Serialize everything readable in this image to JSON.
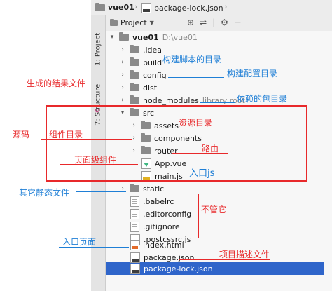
{
  "breadcrumb": {
    "project": "vue01",
    "file": "package-lock.json"
  },
  "side_tabs": {
    "project": "1: Project",
    "structure": "7: Structure"
  },
  "toolbar": {
    "view_label": "Project",
    "icons": [
      "target-icon",
      "split-icon",
      "gear-icon",
      "collapse-icon"
    ]
  },
  "tree": {
    "root": {
      "name": "vue01",
      "path": "D:\\vue01"
    },
    "items": {
      "idea": ".idea",
      "build": "build",
      "config": "config",
      "dist": "dist",
      "node_modules": "node_modules",
      "node_modules_tag": "library root",
      "src": "src",
      "assets": "assets",
      "components": "components",
      "router": "router",
      "app_vue": "App.vue",
      "main_js": "main.js",
      "static": "static",
      "babelrc": ".babelrc",
      "editorconfig": ".editorconfig",
      "gitignore": ".gitignore",
      "postcssrc": ".postcssrc.js",
      "index_html": "index.html",
      "package_json": "package.json",
      "package_lock": "package-lock.json"
    }
  },
  "annotations": {
    "build_dir": "构建脚本的目录",
    "config_dir": "构建配置目录",
    "dist_result": "生成的结果文件",
    "deps_dir": "依赖的包目录",
    "source": "源码",
    "component_dir": "组件目录",
    "asset_dir": "资源目录",
    "route": "路由",
    "page_component": "页面级组件",
    "entry_js": "入口js",
    "other_static": "其它静态文件",
    "not_care": "不管它",
    "entry_page": "入口页面",
    "project_desc": "项目描述文件"
  },
  "colors": {
    "annotation_red": "#e8292b",
    "annotation_blue": "#1f7fd6",
    "selection": "#2f65ca"
  }
}
